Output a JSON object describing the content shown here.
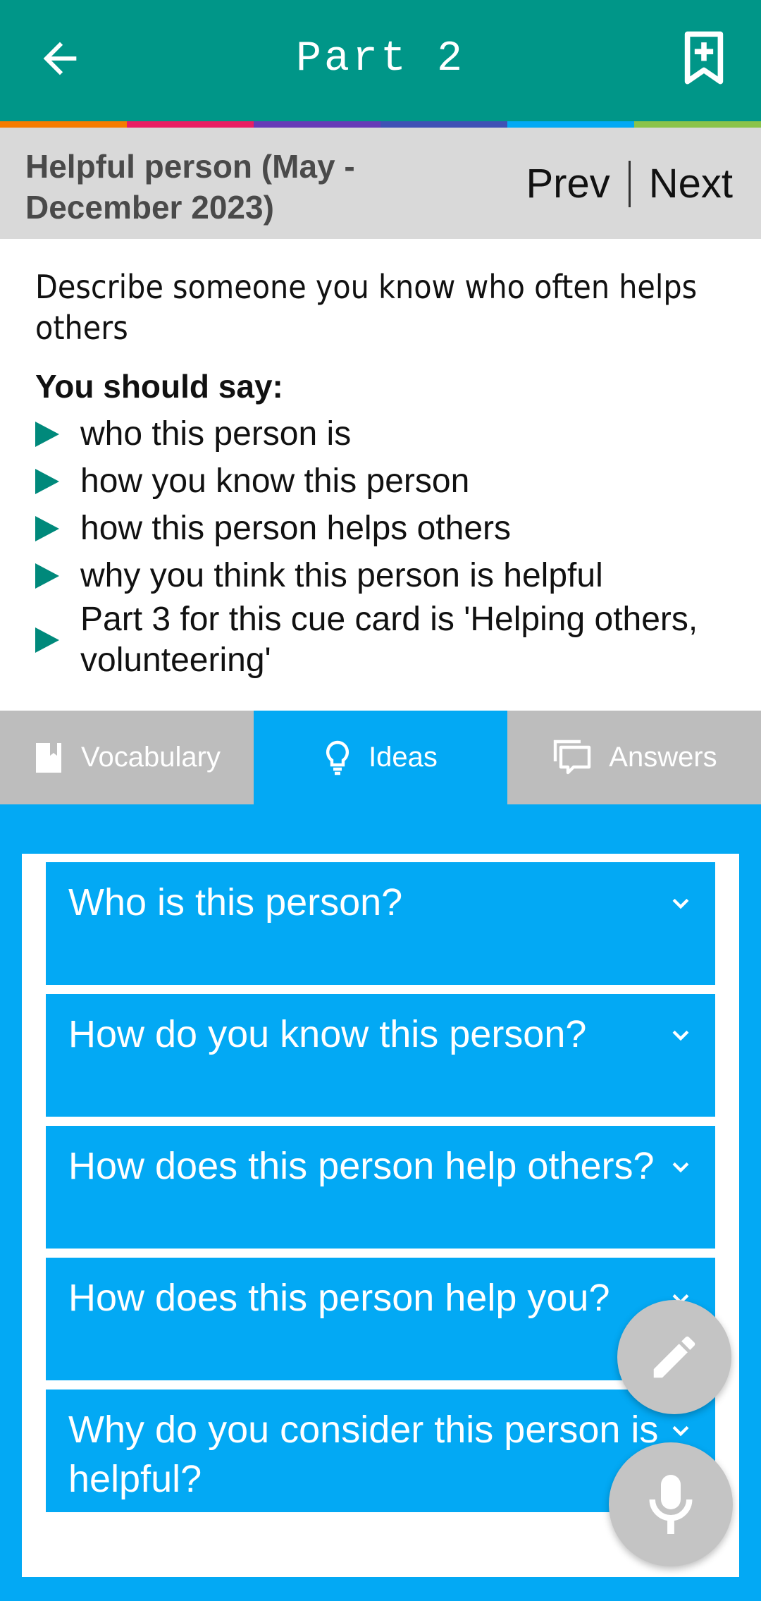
{
  "appbar": {
    "title": "Part 2",
    "back_icon": "arrow-left-icon",
    "bookmark_icon": "bookmark-add-icon",
    "stripe_colors": [
      "#f57c00",
      "#e91e63",
      "#673ab7",
      "#3f51b5",
      "#03a9f4",
      "#8bc34a"
    ]
  },
  "header": {
    "topic": "Helpful person (May - December 2023)",
    "prev_label": "Prev",
    "next_label": "Next"
  },
  "cue_card": {
    "prompt": "Describe someone you know who often helps others",
    "should_say": "You should say:",
    "points": [
      "who this person is",
      "how you know this person",
      "how this person helps others",
      "why you think this person is helpful",
      "Part 3 for this cue card is 'Helping others, volunteering'"
    ]
  },
  "tabs": [
    {
      "label": "Vocabulary",
      "icon": "book-icon",
      "active": false
    },
    {
      "label": "Ideas",
      "icon": "lightbulb-icon",
      "active": true
    },
    {
      "label": "Answers",
      "icon": "chat-icon",
      "active": false
    }
  ],
  "ideas": [
    {
      "question": "Who is this person?"
    },
    {
      "question": "How do you know this person?"
    },
    {
      "question": "How does this person help others?"
    },
    {
      "question": "How does this person help you?"
    },
    {
      "question": "Why do you consider  this person is helpful?"
    }
  ],
  "fabs": {
    "edit_icon": "pencil-icon",
    "mic_icon": "microphone-icon"
  },
  "colors": {
    "appbar": "#009688",
    "accent": "#03a9f4",
    "bullet": "#00897b",
    "tab_inactive": "#bdbdbd",
    "fab": "#c4c4c4"
  }
}
